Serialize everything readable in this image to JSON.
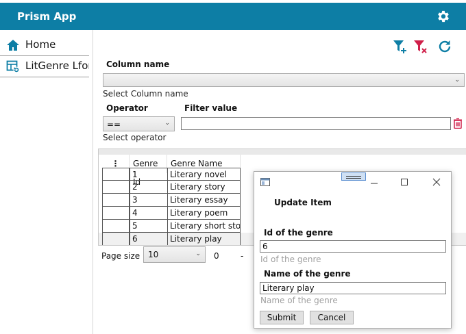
{
  "app": {
    "title": "Prism App"
  },
  "sidebar": {
    "items": [
      {
        "label": "Home",
        "icon": "home-icon"
      },
      {
        "label": "LitGenre Lform",
        "icon": "table-refresh-icon"
      }
    ]
  },
  "toolbar": {
    "icons": [
      "filter-add-icon",
      "filter-clear-icon",
      "refresh-icon"
    ]
  },
  "filter": {
    "column_label": "Column name",
    "column_value": "",
    "column_hint": "Select Column name",
    "operator_label": "Operator",
    "operator_value": "==",
    "operator_hint": "Select operator",
    "value_label": "Filter value",
    "value_text": ""
  },
  "grid": {
    "headers": [
      "Genre Id",
      "Genre Name"
    ],
    "rows": [
      {
        "id": "1",
        "name": "Literary novel"
      },
      {
        "id": "2",
        "name": "Literary story"
      },
      {
        "id": "3",
        "name": "Literary essay"
      },
      {
        "id": "4",
        "name": "Literary poem"
      },
      {
        "id": "5",
        "name": "Literary short story"
      },
      {
        "id": "6",
        "name": "Literary play"
      }
    ]
  },
  "pager": {
    "size_label": "Page size",
    "size_value": "10",
    "from": "0",
    "separator": "-"
  },
  "dialog": {
    "title": "Update Item",
    "id_label": "Id of the genre",
    "id_value": "6",
    "id_hint": "Id of the genre",
    "name_label": "Name of the genre",
    "name_value": "Literary play",
    "name_hint": "Name of the genre",
    "submit_label": "Submit",
    "cancel_label": "Cancel"
  },
  "colors": {
    "accent": "#0d7ea5",
    "filter_clear": "#d0204a",
    "trash": "#d0204a"
  }
}
